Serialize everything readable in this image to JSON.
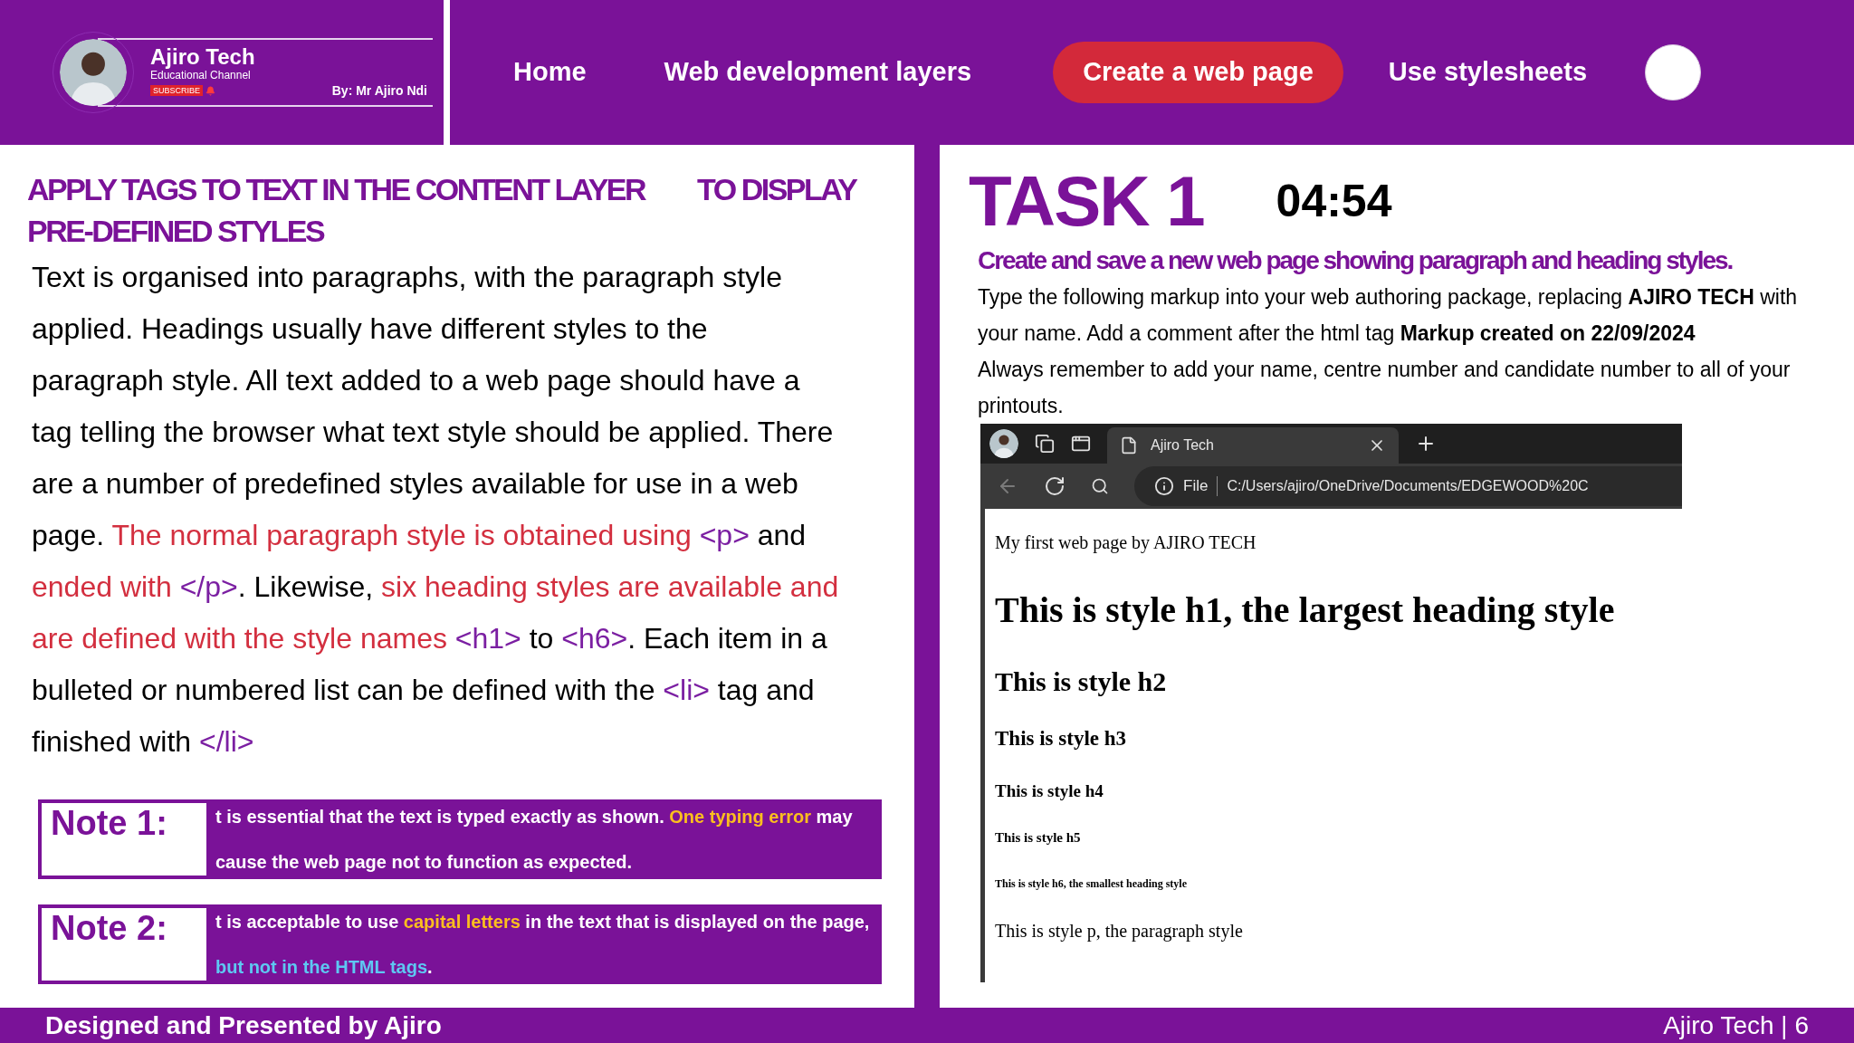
{
  "logo": {
    "title": "Ajiro Tech",
    "subtitle": "Educational Channel",
    "subscribe": "SUBSCRIBE",
    "byline": "By: Mr Ajiro Ndi"
  },
  "nav": [
    {
      "label": "Home",
      "selected": false
    },
    {
      "label": "Web development layers",
      "selected": false
    },
    {
      "label": "Create a web page",
      "selected": true
    },
    {
      "label": "Use stylesheets",
      "selected": false
    }
  ],
  "lesson": {
    "heading": [
      "APPLY TAGS TO TEXT IN THE CONTENT LAYER",
      "TO DISPLAY",
      "PRE-DEFINED STYLES"
    ],
    "segments": [
      {
        "text": "Text is organised into paragraphs, with the paragraph style applied. Headings usually have different styles to the paragraph style. All text added to a web page should have a tag telling the browser what text style should be applied. There are a number of predefined styles available for use in a web page. ",
        "kind": "plain"
      },
      {
        "text": "The normal paragraph style is obtained using ",
        "kind": "emphasis"
      },
      {
        "text": "<p>",
        "kind": "tag"
      },
      {
        "text": " and ",
        "kind": "plain"
      },
      {
        "text": "ended with ",
        "kind": "emphasis"
      },
      {
        "text": "</p>",
        "kind": "tag"
      },
      {
        "text": ". Likewise, ",
        "kind": "plain"
      },
      {
        "text": "six heading styles are available and are defined with the style names ",
        "kind": "emphasis"
      },
      {
        "text": "<h1>",
        "kind": "tag"
      },
      {
        "text": " to ",
        "kind": "plain"
      },
      {
        "text": "<h6>",
        "kind": "tag"
      },
      {
        "text": ". Each item in a bulleted or numbered list can be defined with the ",
        "kind": "plain"
      },
      {
        "text": "<li>",
        "kind": "tag"
      },
      {
        "text": " tag and finished with ",
        "kind": "plain"
      },
      {
        "text": "</li>",
        "kind": "tag"
      }
    ],
    "notes": [
      {
        "label": "Note 1:",
        "segments": [
          {
            "text": "t is essential that the text is typed exactly as shown. ",
            "kind": "plain"
          },
          {
            "text": "One typing error",
            "kind": "highlight"
          },
          {
            "text": " may cause the web page not to function as expected.",
            "kind": "plain"
          }
        ]
      },
      {
        "label": "Note 2:",
        "segments": [
          {
            "text": "t is acceptable to use ",
            "kind": "plain"
          },
          {
            "text": "capital letters",
            "kind": "highlight"
          },
          {
            "text": " in the text that is displayed on the page, ",
            "kind": "plain"
          },
          {
            "text": "but not in the HTML tags",
            "kind": "link"
          },
          {
            "text": ".",
            "kind": "plain"
          }
        ]
      }
    ]
  },
  "task": {
    "title": "TASK 1",
    "timer": "04:54",
    "subtitle": "Create and save a new web page showing paragraph and heading styles.",
    "instructions": [
      "Type the following markup into your web authoring package, replacing **AJIRO TECH** with your name. Add a comment after the html tag **Markup created on 22/09/2024**",
      "Always remember to add your name, centre number and candidate number to all of your printouts."
    ]
  },
  "browser": {
    "tab_title": "Ajiro Tech",
    "back_disabled": true,
    "scheme": "File",
    "url": "C:/Users/ajiro/OneDrive/Documents/EDGEWOOD%20C",
    "page": [
      {
        "kind": "p",
        "text": "My first web page by AJIRO TECH"
      },
      {
        "kind": "h1",
        "text": "This is style h1, the largest heading style"
      },
      {
        "kind": "h2",
        "text": "This is style h2"
      },
      {
        "kind": "h3",
        "text": "This is style h3"
      },
      {
        "kind": "h4",
        "text": "This is style h4"
      },
      {
        "kind": "h5",
        "text": "This is style h5"
      },
      {
        "kind": "h6",
        "text": "This is style h6, the smallest heading style"
      },
      {
        "kind": "p",
        "text": "This is style p, the paragraph style"
      }
    ]
  },
  "footer": {
    "left": "Designed and Presented by Ajiro",
    "right": "Ajiro Tech | 6"
  }
}
